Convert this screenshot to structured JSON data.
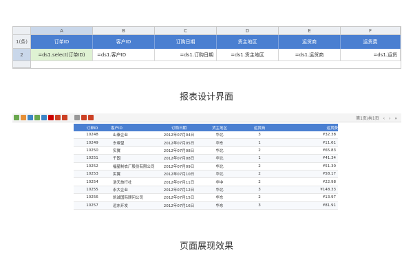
{
  "designer": {
    "columns": [
      "A",
      "B",
      "C",
      "D",
      "E",
      "F"
    ],
    "rows": [
      "1(条)",
      "2"
    ],
    "headers": [
      "订单ID",
      "客户ID",
      "订购日期",
      "货主地区",
      "运货商",
      "运货费"
    ],
    "formulas": [
      "=ds1.select(订单ID)",
      "=ds1.客户ID",
      "=ds1.订购日期",
      "=ds1.货主地区",
      "=ds1.运货商",
      "=ds1.运货"
    ]
  },
  "caption_design": "报表设计界面",
  "toolbar": {
    "pager": [
      "第1页/共1页",
      "‹",
      "›",
      "»"
    ]
  },
  "preview": {
    "headers": [
      "订单ID",
      "客户ID",
      "订购日期",
      "货主地区",
      "运货商",
      "运货费"
    ],
    "rows": [
      [
        "10248",
        "山泰企业",
        "2012年07月04日",
        "华北",
        "3",
        "¥32.38"
      ],
      [
        "10249",
        "东帝望",
        "2012年07月05日",
        "华东",
        "1",
        "¥11.61"
      ],
      [
        "10250",
        "实翼",
        "2012年07月08日",
        "华北",
        "2",
        "¥65.83"
      ],
      [
        "10251",
        "千固",
        "2012年07月08日",
        "华北",
        "1",
        "¥41.34"
      ],
      [
        "10252",
        "福星制衣厂股份有限公司",
        "2012年07月09日",
        "华北",
        "2",
        "¥51.30"
      ],
      [
        "10253",
        "实翼",
        "2012年07月10日",
        "华北",
        "2",
        "¥58.17"
      ],
      [
        "10254",
        "浩天旅行社",
        "2012年07月11日",
        "华中",
        "2",
        "¥22.98"
      ],
      [
        "10255",
        "永大企业",
        "2012年07月12日",
        "华北",
        "3",
        "¥148.33"
      ],
      [
        "10256",
        "凯诚国际顾问公司",
        "2012年07月15日",
        "华东",
        "2",
        "¥13.97"
      ],
      [
        "10257",
        "远东开发",
        "2012年07月16日",
        "华东",
        "3",
        "¥81.91"
      ]
    ]
  },
  "caption_preview": "页面展现效果",
  "colors": {
    "header_blue": "#4a7fd1",
    "formula_green": "#dff2d3",
    "selected_header": "#c9d7ea"
  }
}
